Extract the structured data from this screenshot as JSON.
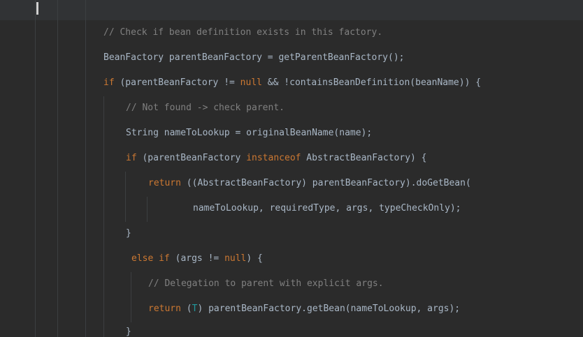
{
  "theme": {
    "background": "#2b2b2b",
    "top_band": "#313335",
    "default_text": "#a9b7c6",
    "keyword": "#cc7832",
    "comment": "#808080",
    "type_param": "#20999d"
  },
  "code": {
    "line1": "// Check if bean definition exists in this factory.",
    "line2": "BeanFactory parentBeanFactory = getParentBeanFactory();",
    "line3": {
      "kw_if": "if",
      "rest1": " (parentBeanFactory != ",
      "kw_null": "null",
      "rest2": " && !containsBeanDefinition(beanName)) {"
    },
    "line4": "// Not found -> check parent.",
    "line5": "String nameToLookup = originalBeanName(name);",
    "line6": {
      "kw_if": "if",
      "rest1": " (parentBeanFactory ",
      "kw_instanceof": "instanceof",
      "rest2": " AbstractBeanFactory) {"
    },
    "line7": {
      "kw_return": "return",
      "rest": " ((AbstractBeanFactory) parentBeanFactory).doGetBean("
    },
    "line8": "nameToLookup, requiredType, args, typeCheckOnly);",
    "line9": "}",
    "line10": {
      "kw_else": "else",
      "kw_if": "if",
      "rest1": " (args != ",
      "kw_null": "null",
      "rest2": ") {"
    },
    "line11": "// Delegation to parent with explicit args.",
    "line12": {
      "kw_return": "return",
      "open": " (",
      "type_t": "T",
      "rest": ") parentBeanFactory.getBean(nameToLookup, args);"
    },
    "line13": "}"
  }
}
